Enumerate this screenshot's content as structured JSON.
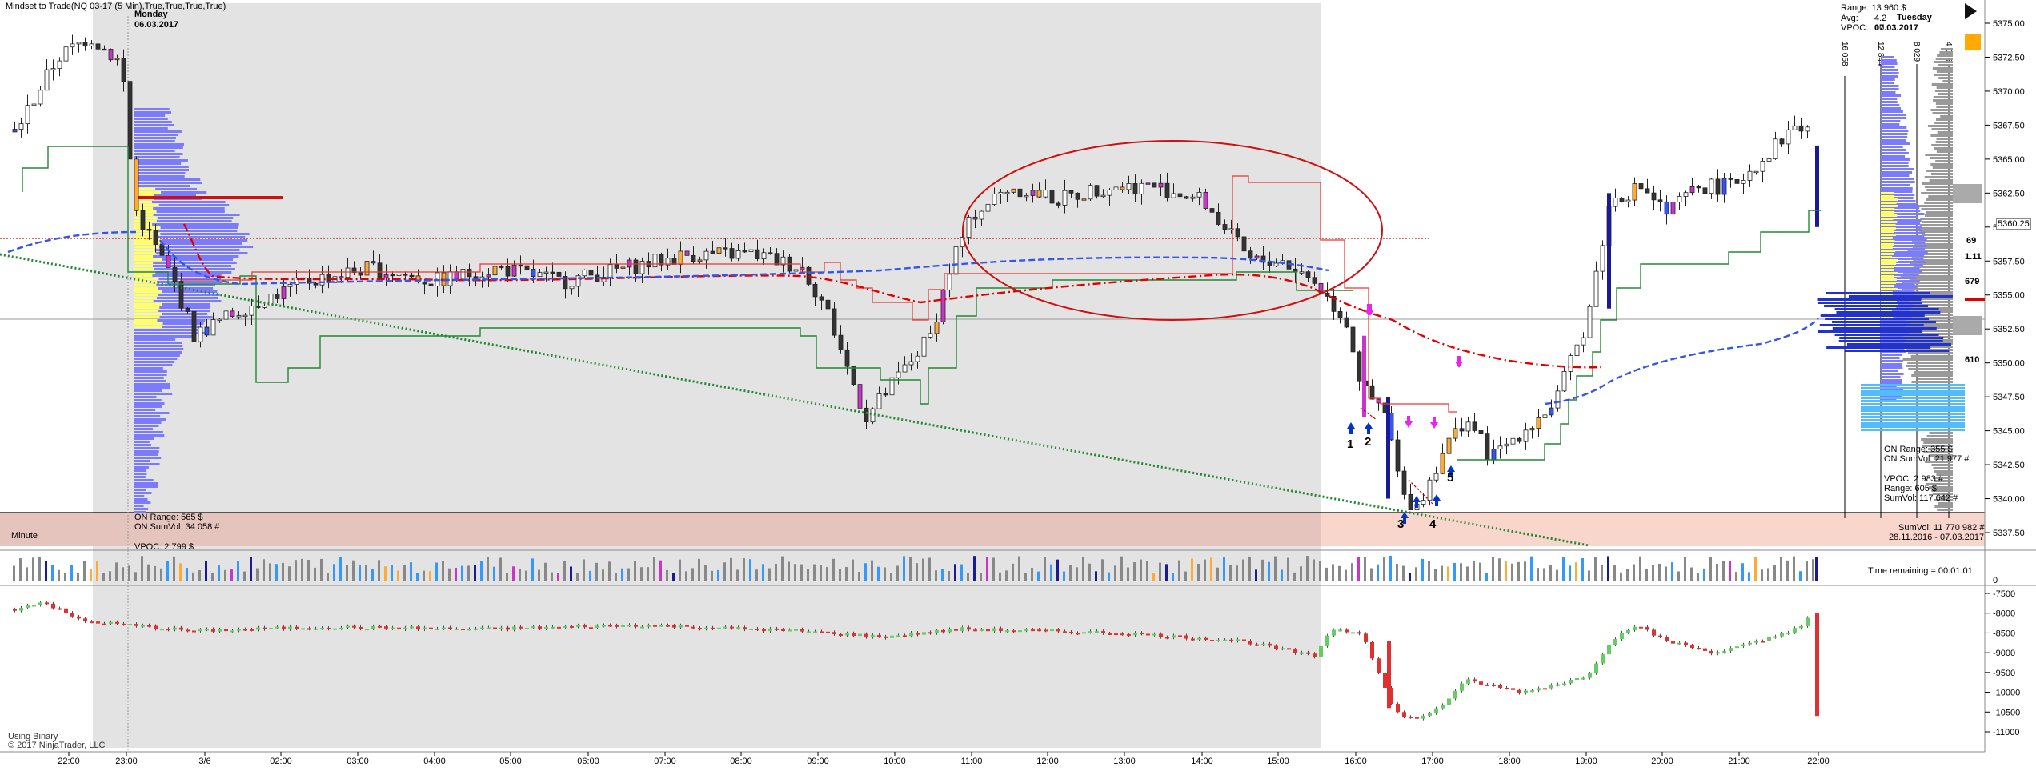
{
  "header": {
    "title": "Mindset to Trade(NQ 03-17 (5 Min),True,True,True,True)",
    "monday_label": "Monday",
    "monday_date": "06.03.2017",
    "tuesday_label": "Tuesday",
    "tuesday_date": "07.03.2017"
  },
  "stats_top_right": {
    "range": "Range: 13 960 $",
    "avg": "Avg:",
    "avg_value": "4.2",
    "vpoc": "VPOC:",
    "vpoc_value": "10"
  },
  "session_mon": {
    "on_range": "ON Range:   565 $",
    "on_sumvol": "ON SumVol:  34 058 #",
    "vpoc_cut": "VPOC:      2 799 $"
  },
  "session_tue": {
    "on_range": "ON Range:   355 $",
    "on_sumvol": "ON SumVol:  21 977 #",
    "vpoc": "VPOC:     2 983 #",
    "range": "Range:    605 $",
    "sumvol": "SumVol:  117 642 #",
    "sumvol_total": "SumVol: 11 770 982 #",
    "date_range": "28.11.2016 - 07.03.2017"
  },
  "vertical_vol_labels": [
    "16 058",
    "12 844",
    "8 029",
    "4 015"
  ],
  "right_markers": [
    "69",
    "1.11",
    "679",
    "610"
  ],
  "minute_label": "Minute",
  "time_remaining": "Time remaining = 00:01:01",
  "footer": {
    "line1": "Using Binary",
    "line2": "© 2017 NinjaTrader, LLC"
  },
  "trade_numbers": [
    "1",
    "2",
    "3",
    "4",
    "5"
  ],
  "current_price": "5360.25",
  "price_axis": [
    "5375.00",
    "5372.50",
    "5370.00",
    "5367.50",
    "5365.00",
    "5362.50",
    "5360.00",
    "5357.50",
    "5355.00",
    "5352.50",
    "5350.00",
    "5347.50",
    "5345.00",
    "5342.50",
    "5340.00",
    "5337.50"
  ],
  "volume_axis": [
    "0"
  ],
  "indicator_axis": [
    "-7500",
    "-8000",
    "-8500",
    "-9000",
    "-9500",
    "-10000",
    "-10500",
    "-11000"
  ],
  "time_axis": [
    "22:00",
    "23:00",
    "3/6",
    "02:00",
    "03:00",
    "04:00",
    "05:00",
    "06:00",
    "07:00",
    "08:00",
    "09:00",
    "10:00",
    "11:00",
    "12:00",
    "13:00",
    "14:00",
    "15:00",
    "16:00",
    "17:00",
    "18:00",
    "19:00",
    "20:00",
    "21:00",
    "22:00"
  ],
  "colors": {
    "session_shade": "#e3e3e3",
    "profile_blue": "#7b7bff",
    "profile_yellow": "#ffff66",
    "ema_red": "#e00000",
    "vwap_blue": "#3355ee",
    "trend_green": "#228833",
    "pnl_red": "#e03030",
    "pnl_green": "#66cc66"
  }
}
